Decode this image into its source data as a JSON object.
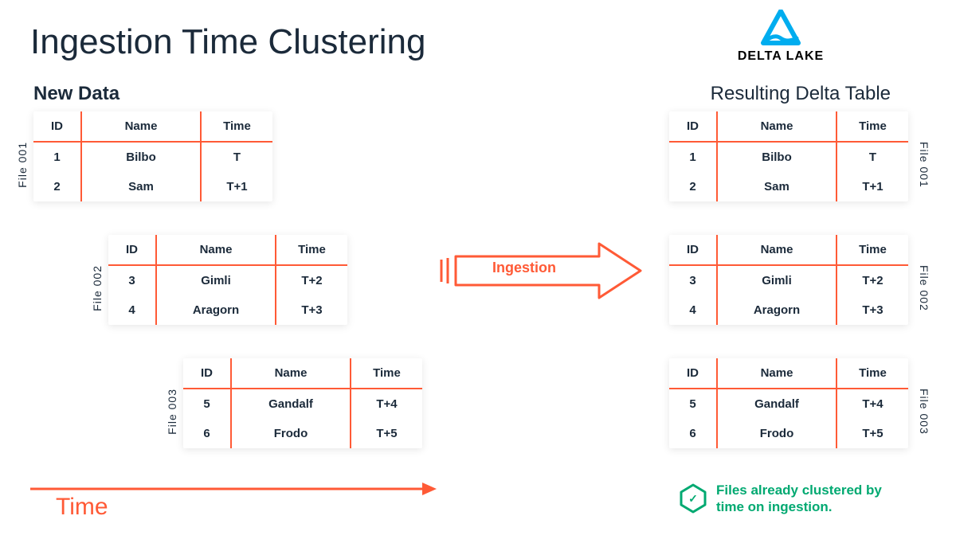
{
  "title": "Ingestion Time Clustering",
  "new_data": {
    "label": "New Data"
  },
  "delta_brand": {
    "name": "DELTA LAKE"
  },
  "resulting": {
    "label": "Resulting Delta Table"
  },
  "columns": {
    "id": "ID",
    "name": "Name",
    "time": "Time"
  },
  "files": {
    "left": [
      {
        "label": "File 001",
        "rows": [
          {
            "id": "1",
            "name": "Bilbo",
            "time": "T"
          },
          {
            "id": "2",
            "name": "Sam",
            "time": "T+1"
          }
        ]
      },
      {
        "label": "File 002",
        "rows": [
          {
            "id": "3",
            "name": "Gimli",
            "time": "T+2"
          },
          {
            "id": "4",
            "name": "Aragorn",
            "time": "T+3"
          }
        ]
      },
      {
        "label": "File 003",
        "rows": [
          {
            "id": "5",
            "name": "Gandalf",
            "time": "T+4"
          },
          {
            "id": "6",
            "name": "Frodo",
            "time": "T+5"
          }
        ]
      }
    ],
    "right": [
      {
        "label": "File 001",
        "rows": [
          {
            "id": "1",
            "name": "Bilbo",
            "time": "T"
          },
          {
            "id": "2",
            "name": "Sam",
            "time": "T+1"
          }
        ]
      },
      {
        "label": "File 002",
        "rows": [
          {
            "id": "3",
            "name": "Gimli",
            "time": "T+2"
          },
          {
            "id": "4",
            "name": "Aragorn",
            "time": "T+3"
          }
        ]
      },
      {
        "label": "File 003",
        "rows": [
          {
            "id": "5",
            "name": "Gandalf",
            "time": "T+4"
          },
          {
            "id": "6",
            "name": "Frodo",
            "time": "T+5"
          }
        ]
      }
    ]
  },
  "ingestion_label": "Ingestion",
  "time_axis_label": "Time",
  "callout": {
    "text": "Files already clustered by time on ingestion.",
    "icon_glyph": "✓"
  },
  "colors": {
    "accent": "#ff5a36",
    "success": "#00a971",
    "text": "#1b2a3a",
    "logo": "#00adef"
  }
}
